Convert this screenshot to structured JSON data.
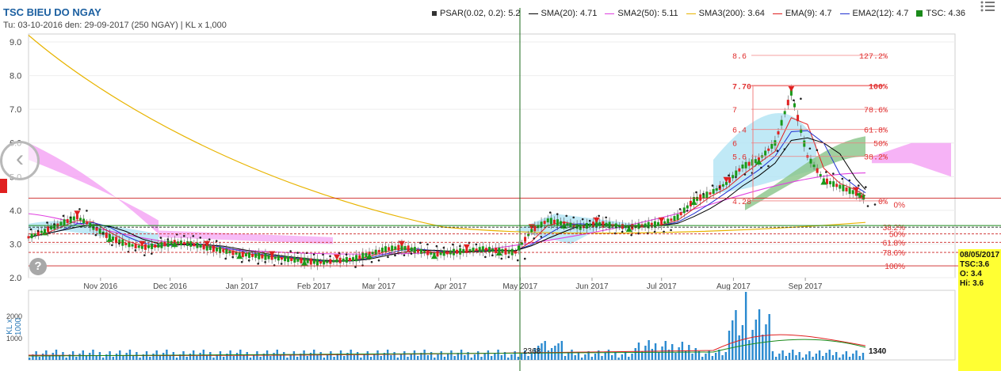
{
  "title": "TSC BIEU DO NGAY",
  "subtitle": "Tu: 03-10-2016 den: 29-09-2017 (250 NGAY) | KL x 1,000",
  "legend": [
    {
      "label": "PSAR(0.02, 0.2): 5.2",
      "color": "#333333",
      "kind": "dot"
    },
    {
      "label": "SMA(20): 4.71",
      "color": "#000000",
      "kind": "line"
    },
    {
      "label": "SMA2(50): 5.11",
      "color": "#e040e0",
      "kind": "line"
    },
    {
      "label": "SMA3(200): 3.64",
      "color": "#e8b400",
      "kind": "line"
    },
    {
      "label": "EMA(9): 4.7",
      "color": "#e02020",
      "kind": "line"
    },
    {
      "label": "EMA2(12): 4.7",
      "color": "#2030d0",
      "kind": "line"
    },
    {
      "label": "TSC: 4.36",
      "color": "#1a8a1a",
      "kind": "square"
    }
  ],
  "info_box": {
    "date": "08/05/2017",
    "symbol": "TSC:3.6",
    "open_label": "O:",
    "open": "3.4",
    "high_label": "Hi:",
    "high": "3.6"
  },
  "ui": {
    "back_icon": "chevron-left-icon",
    "help_icon": "question-icon",
    "menu_icon": "menu-icon",
    "help_text": "?",
    "back_text": "‹"
  },
  "chart_data": {
    "type": "candlestick",
    "y_axis": {
      "min": 2.0,
      "max": 9.0,
      "ticks": [
        "2.0",
        "3.0",
        "4.0",
        "5.0",
        "6.0",
        "7.0",
        "8.0",
        "9.0"
      ]
    },
    "x_ticks": [
      "Nov 2016",
      "Dec 2016",
      "Jan 2017",
      "Feb 2017",
      "Mar 2017",
      "Apr 2017",
      "May 2017",
      "Jun 2017",
      "Jul 2017",
      "Aug 2017",
      "Sep 2017"
    ],
    "volume_axis_label": "KL x 1000",
    "volume_ticks": [
      "1000",
      "2000"
    ],
    "last_volume": "1340",
    "cursor_volume": "2368",
    "fib_upper": [
      {
        "price": "8.6",
        "pct": "127.2%"
      },
      {
        "price": "7.70",
        "pct": "100%"
      },
      {
        "price": "7",
        "pct": "78.6%"
      },
      {
        "price": "6.4",
        "pct": "61.8%"
      },
      {
        "price": "6",
        "pct": "50%"
      },
      {
        "price": "5.6",
        "pct": "38.2%"
      },
      {
        "price": "4.28",
        "pct": "0%"
      }
    ],
    "fib_lower": [
      "0%",
      "38.2%",
      "50%",
      "61.8%",
      "78.6%",
      "100%"
    ],
    "price_path": [
      [
        "2016-10-03",
        3.2
      ],
      [
        "2016-10-10",
        3.4
      ],
      [
        "2016-10-17",
        3.6
      ],
      [
        "2016-10-24",
        3.8
      ],
      [
        "2016-10-31",
        3.5
      ],
      [
        "2016-11-07",
        3.2
      ],
      [
        "2016-11-14",
        3.0
      ],
      [
        "2016-11-21",
        2.9
      ],
      [
        "2016-11-28",
        2.95
      ],
      [
        "2016-12-05",
        3.05
      ],
      [
        "2016-12-12",
        3.0
      ],
      [
        "2016-12-19",
        2.9
      ],
      [
        "2016-12-26",
        2.8
      ],
      [
        "2017-01-02",
        2.7
      ],
      [
        "2017-01-09",
        2.65
      ],
      [
        "2017-01-16",
        2.6
      ],
      [
        "2017-01-23",
        2.55
      ],
      [
        "2017-01-30",
        2.5
      ],
      [
        "2017-02-06",
        2.45
      ],
      [
        "2017-02-13",
        2.5
      ],
      [
        "2017-02-20",
        2.55
      ],
      [
        "2017-02-27",
        2.7
      ],
      [
        "2017-03-06",
        2.85
      ],
      [
        "2017-03-13",
        2.9
      ],
      [
        "2017-03-20",
        2.8
      ],
      [
        "2017-03-27",
        2.7
      ],
      [
        "2017-04-03",
        2.75
      ],
      [
        "2017-04-10",
        2.8
      ],
      [
        "2017-04-17",
        2.85
      ],
      [
        "2017-04-24",
        2.8
      ],
      [
        "2017-05-01",
        2.75
      ],
      [
        "2017-05-08",
        3.4
      ],
      [
        "2017-05-15",
        3.7
      ],
      [
        "2017-05-22",
        3.6
      ],
      [
        "2017-05-29",
        3.5
      ],
      [
        "2017-06-05",
        3.6
      ],
      [
        "2017-06-12",
        3.55
      ],
      [
        "2017-06-19",
        3.5
      ],
      [
        "2017-06-26",
        3.55
      ],
      [
        "2017-07-03",
        3.6
      ],
      [
        "2017-07-10",
        3.8
      ],
      [
        "2017-07-17",
        4.3
      ],
      [
        "2017-07-24",
        4.5
      ],
      [
        "2017-07-31",
        4.8
      ],
      [
        "2017-08-07",
        5.3
      ],
      [
        "2017-08-14",
        5.5
      ],
      [
        "2017-08-21",
        6.0
      ],
      [
        "2017-08-28",
        7.5
      ],
      [
        "2017-09-04",
        5.6
      ],
      [
        "2017-09-11",
        4.9
      ],
      [
        "2017-09-18",
        4.7
      ],
      [
        "2017-09-25",
        4.5
      ],
      [
        "2017-09-29",
        4.36
      ]
    ]
  }
}
